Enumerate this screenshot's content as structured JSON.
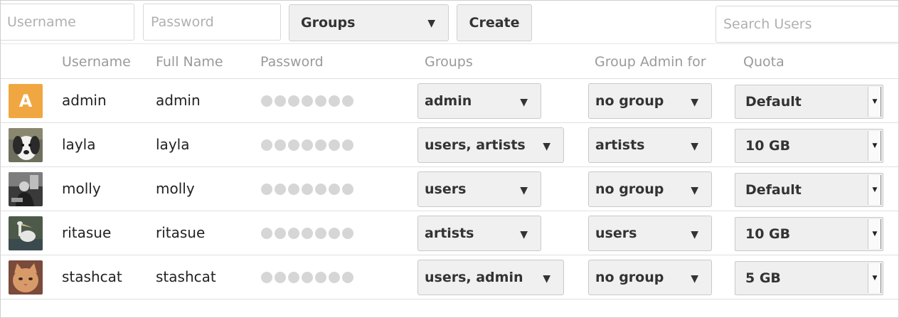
{
  "toolbar": {
    "username_placeholder": "Username",
    "password_placeholder": "Password",
    "groups_label": "Groups",
    "create_label": "Create",
    "search_placeholder": "Search Users"
  },
  "columns": [
    "Username",
    "Full Name",
    "Password",
    "Groups",
    "Group Admin for",
    "Quota"
  ],
  "users": [
    {
      "username": "admin",
      "fullname": "admin",
      "groups": "admin",
      "group_admin": "no group",
      "quota": "Default",
      "avatar": "letter-avatar",
      "avatar_letter": "A"
    },
    {
      "username": "layla",
      "fullname": "layla",
      "groups": "users, artists",
      "group_admin": "artists",
      "quota": "10 GB",
      "avatar": "dog-photo-avatar"
    },
    {
      "username": "molly",
      "fullname": "molly",
      "groups": "users",
      "group_admin": "no group",
      "quota": "Default",
      "avatar": "person-photo-avatar"
    },
    {
      "username": "ritasue",
      "fullname": "ritasue",
      "groups": "artists",
      "group_admin": "users",
      "quota": "10 GB",
      "avatar": "pelican-photo-avatar"
    },
    {
      "username": "stashcat",
      "fullname": "stashcat",
      "groups": "users, admin",
      "group_admin": "no group",
      "quota": "5 GB",
      "avatar": "cat-photo-avatar"
    }
  ],
  "icons": {
    "dropdown": "triangle-down-icon"
  },
  "colors": {
    "avatar_accent": "#f0a742",
    "control_bg": "#f0f0f0",
    "header_text": "#9a9a9a"
  }
}
